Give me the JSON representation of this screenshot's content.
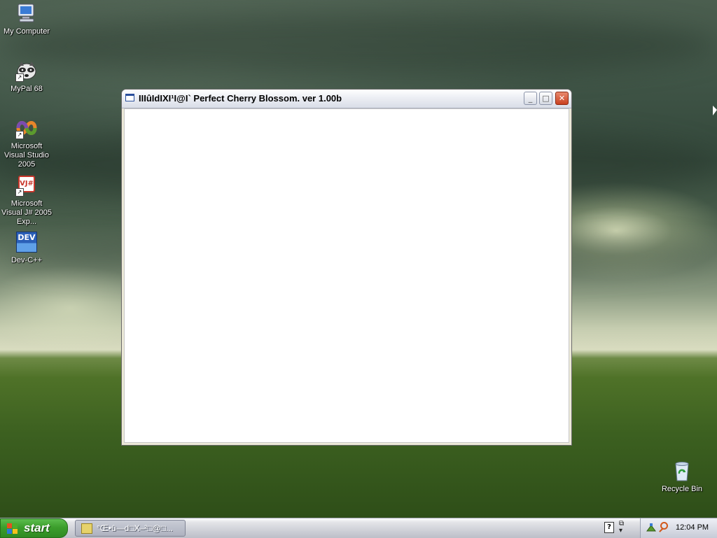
{
  "desktop": {
    "icons": [
      {
        "label": "My Computer",
        "icon": "my-computer-icon"
      },
      {
        "label": "MyPal 68",
        "icon": "mypal-raccoon-icon"
      },
      {
        "label": "Microsoft Visual Studio 2005",
        "icon": "visual-studio-icon"
      },
      {
        "label": "Microsoft Visual J# 2005 Exp...",
        "icon": "visual-jsharp-icon",
        "badge": "VJ#"
      },
      {
        "label": "Dev-C++",
        "icon": "dev-cpp-icon",
        "badge": "DEV"
      },
      {
        "label": "Recycle Bin",
        "icon": "recycle-bin-icon"
      }
    ]
  },
  "window": {
    "title": "IIIûIdIXI¹I@I` Perfect Cherry Blossom. ver 1.00b",
    "controls": {
      "minimize": "_",
      "maximize": "□",
      "close": "✕"
    }
  },
  "taskbar": {
    "start_label": "start",
    "task_button_label": "°Œ•û—d□X–²□@□...",
    "help_glyph": "?",
    "clock": "12:04 PM"
  },
  "colors": {
    "start_green": "#3c9e2c",
    "close_red": "#c9401f",
    "flag_red": "#e8501e",
    "flag_green": "#4cae2a",
    "flag_blue": "#2a78d8",
    "flag_yellow": "#f6c21c"
  }
}
